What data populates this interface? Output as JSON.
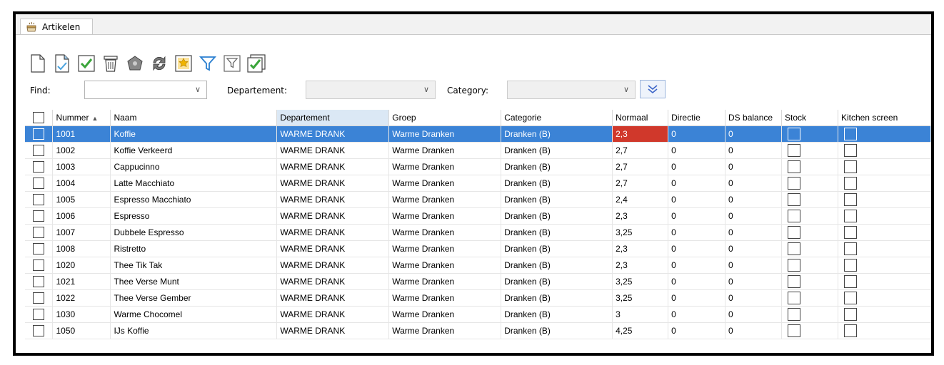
{
  "tab": {
    "label": "Artikelen",
    "icon": "coffee-cup-icon"
  },
  "toolbar": {
    "buttons": [
      {
        "name": "new-document-icon",
        "tip": ""
      },
      {
        "name": "copy-document-icon",
        "tip": ""
      },
      {
        "name": "checkmark-icon",
        "tip": ""
      },
      {
        "name": "trash-icon",
        "tip": ""
      },
      {
        "name": "shape-icon",
        "tip": ""
      },
      {
        "name": "refresh-icon",
        "tip": ""
      },
      {
        "name": "favorite-icon",
        "tip": ""
      },
      {
        "name": "filter-icon",
        "tip": ""
      },
      {
        "name": "filter-outline-icon",
        "tip": ""
      },
      {
        "name": "check-all-icon",
        "tip": ""
      }
    ]
  },
  "filters": {
    "find_label": "Find:",
    "find_value": "",
    "departement_label": "Departement:",
    "departement_value": "",
    "category_label": "Category:",
    "category_value": ""
  },
  "table": {
    "columns": [
      "Nummer",
      "Naam",
      "Departement",
      "Groep",
      "Categorie",
      "Normaal",
      "Directie",
      "DS balance",
      "Stock",
      "Kitchen screen"
    ],
    "rows": [
      {
        "nummer": "1001",
        "naam": "Koffie",
        "departement": "WARME DRANK",
        "groep": "Warme Dranken",
        "categorie": "Dranken (B)",
        "normaal": "2,3",
        "directie": "0",
        "ds": "0"
      },
      {
        "nummer": "1002",
        "naam": "Koffie Verkeerd",
        "departement": "WARME DRANK",
        "groep": "Warme Dranken",
        "categorie": "Dranken (B)",
        "normaal": "2,7",
        "directie": "0",
        "ds": "0"
      },
      {
        "nummer": "1003",
        "naam": "Cappucinno",
        "departement": "WARME DRANK",
        "groep": "Warme Dranken",
        "categorie": "Dranken (B)",
        "normaal": "2,7",
        "directie": "0",
        "ds": "0"
      },
      {
        "nummer": "1004",
        "naam": "Latte Macchiato",
        "departement": "WARME DRANK",
        "groep": "Warme Dranken",
        "categorie": "Dranken (B)",
        "normaal": "2,7",
        "directie": "0",
        "ds": "0"
      },
      {
        "nummer": "1005",
        "naam": "Espresso Macchiato",
        "departement": "WARME DRANK",
        "groep": "Warme Dranken",
        "categorie": "Dranken (B)",
        "normaal": "2,4",
        "directie": "0",
        "ds": "0"
      },
      {
        "nummer": "1006",
        "naam": "Espresso",
        "departement": "WARME DRANK",
        "groep": "Warme Dranken",
        "categorie": "Dranken (B)",
        "normaal": "2,3",
        "directie": "0",
        "ds": "0"
      },
      {
        "nummer": "1007",
        "naam": "Dubbele Espresso",
        "departement": "WARME DRANK",
        "groep": "Warme Dranken",
        "categorie": "Dranken (B)",
        "normaal": "3,25",
        "directie": "0",
        "ds": "0"
      },
      {
        "nummer": "1008",
        "naam": "Ristretto",
        "departement": "WARME DRANK",
        "groep": "Warme Dranken",
        "categorie": "Dranken (B)",
        "normaal": "2,3",
        "directie": "0",
        "ds": "0"
      },
      {
        "nummer": "1020",
        "naam": "Thee Tik Tak",
        "departement": "WARME DRANK",
        "groep": "Warme Dranken",
        "categorie": "Dranken (B)",
        "normaal": "2,3",
        "directie": "0",
        "ds": "0"
      },
      {
        "nummer": "1021",
        "naam": "Thee Verse Munt",
        "departement": "WARME DRANK",
        "groep": "Warme Dranken",
        "categorie": "Dranken (B)",
        "normaal": "3,25",
        "directie": "0",
        "ds": "0"
      },
      {
        "nummer": "1022",
        "naam": "Thee Verse Gember",
        "departement": "WARME DRANK",
        "groep": "Warme Dranken",
        "categorie": "Dranken (B)",
        "normaal": "3,25",
        "directie": "0",
        "ds": "0"
      },
      {
        "nummer": "1030",
        "naam": "Warme Chocomel",
        "departement": "WARME DRANK",
        "groep": "Warme Dranken",
        "categorie": "Dranken (B)",
        "normaal": "3",
        "directie": "0",
        "ds": "0"
      },
      {
        "nummer": "1050",
        "naam": "IJs Koffie",
        "departement": "WARME DRANK",
        "groep": "Warme Dranken",
        "categorie": "Dranken (B)",
        "normaal": "4,25",
        "directie": "0",
        "ds": "0"
      }
    ],
    "selected_row": 0
  },
  "colors": {
    "selection": "#3b83d6",
    "highlight_red": "#d0382b",
    "accent_green": "#3aa53a"
  }
}
